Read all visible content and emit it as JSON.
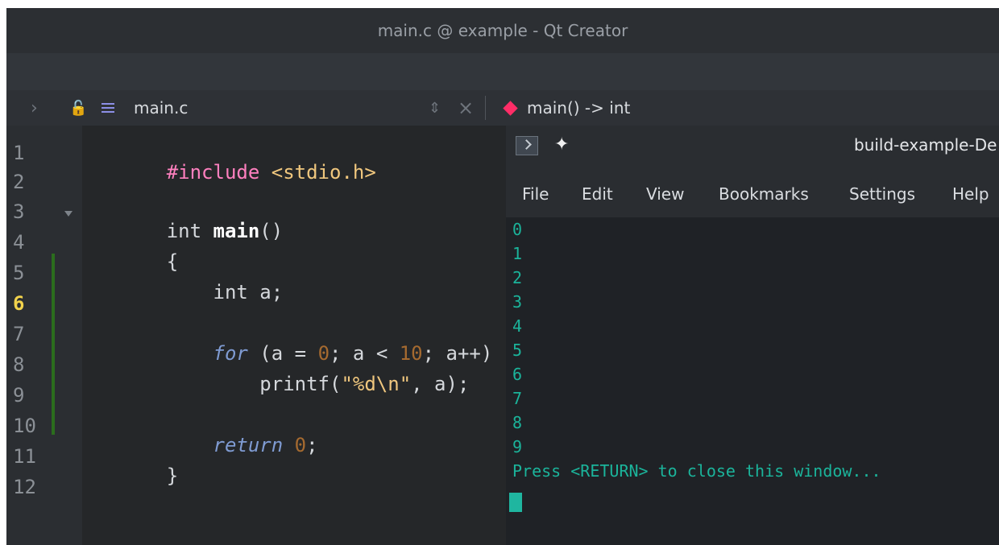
{
  "window": {
    "title": "main.c @ example - Qt Creator"
  },
  "editor": {
    "file_name": "main.c",
    "function_signature": "main() -> int",
    "line_numbers": [
      "1",
      "2",
      "3",
      "4",
      "5",
      "6",
      "7",
      "8",
      "9",
      "10",
      "11",
      "12"
    ],
    "active_line": "6",
    "code_lines": [
      {
        "a": "#include",
        "b": " <stdio.h>"
      },
      {},
      {
        "a": "int ",
        "b": "main",
        "c": "()"
      },
      {
        "a": "{"
      },
      {
        "a": "    int a;"
      },
      {},
      {
        "a": "    for",
        "b": " (a = ",
        "c": "0",
        "d": "; a < ",
        "e": "10",
        "f": "; a++)"
      },
      {
        "a": "        printf(",
        "b": "\"%d\\n\"",
        "c": ", a);"
      },
      {},
      {
        "a": "    return",
        "b": " ",
        "c": "0",
        "d": ";"
      },
      {
        "a": "}"
      },
      {}
    ]
  },
  "terminal": {
    "title": "build-example-De",
    "menu": [
      "File",
      "Edit",
      "View",
      "Bookmarks",
      "Settings",
      "Help"
    ],
    "output": [
      "0",
      "1",
      "2",
      "3",
      "4",
      "5",
      "6",
      "7",
      "8",
      "9",
      "Press <RETURN> to close this window..."
    ]
  }
}
